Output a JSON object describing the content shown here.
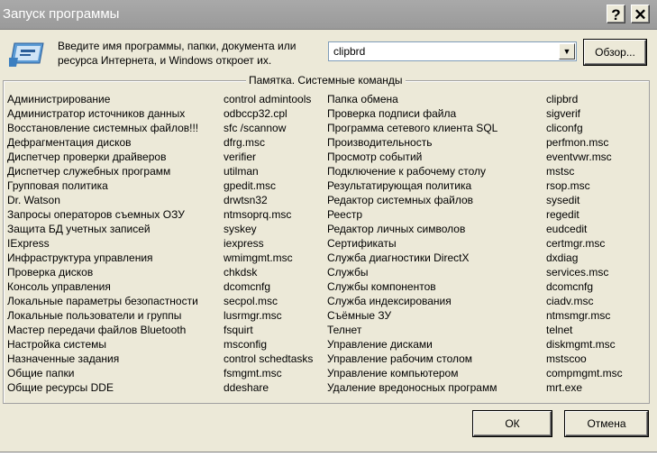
{
  "window": {
    "title": "Запуск программы",
    "help_label": "?",
    "close_label": "✕"
  },
  "prompt": "Введите имя программы, папки, документа или ресурса Интернета, и Windows откроет их.",
  "input": {
    "value": "clipbrd"
  },
  "buttons": {
    "browse": "Обзор...",
    "ok": "ОК",
    "cancel": "Отмена"
  },
  "group_title": "Памятка. Системные команды",
  "commands": [
    [
      "Администрирование",
      "control admintools",
      "Папка обмена",
      "clipbrd"
    ],
    [
      "Администратор источников данных",
      "odbccp32.cpl",
      "Проверка подписи файла",
      "sigverif"
    ],
    [
      "Восстановление системных файлов!!!",
      "sfc /scannow",
      "Программа сетевого клиента SQL",
      "cliconfg"
    ],
    [
      "Дефрагментация дисков",
      "dfrg.msc",
      "Производительность",
      "perfmon.msc"
    ],
    [
      "Диспетчер проверки драйверов",
      "verifier",
      "Просмотр событий",
      "eventvwr.msc"
    ],
    [
      "Диспетчер служебных программ",
      "utilman",
      "Подключение к рабочему столу",
      "mstsc"
    ],
    [
      "Групповая политика",
      "gpedit.msc",
      "Результатирующая политика",
      "rsop.msc"
    ],
    [
      "Dr. Watson",
      "drwtsn32",
      "Редактор системных файлов",
      "sysedit"
    ],
    [
      "Запросы операторов съемных ОЗУ",
      "ntmsoprq.msc",
      "Реестр",
      "regedit"
    ],
    [
      "Защита БД учетных записей",
      "syskey",
      "Редактор личных символов",
      "eudcedit"
    ],
    [
      "IExpress",
      "iexpress",
      "Сертификаты",
      "certmgr.msc"
    ],
    [
      "Инфраструктура управления",
      "wmimgmt.msc",
      "Служба диагностики DirectX",
      "dxdiag"
    ],
    [
      "Проверка дисков",
      "chkdsk",
      "Службы",
      "services.msc"
    ],
    [
      "Консоль управления",
      "dcomcnfg",
      "Службы компонентов",
      "dcomcnfg"
    ],
    [
      "Локальные параметры безопастности",
      "secpol.msc",
      "Служба индексирования",
      "ciadv.msc"
    ],
    [
      "Локальные пользователи и группы",
      "lusrmgr.msc",
      "Съёмные ЗУ",
      "ntmsmgr.msc"
    ],
    [
      "Мастер передачи файлов Bluetooth",
      "fsquirt",
      "Телнет",
      "telnet"
    ],
    [
      "Настройка системы",
      "msconfig",
      "Управление дисками",
      "diskmgmt.msc"
    ],
    [
      "Назначенные задания",
      "control schedtasks",
      "Управление рабочим столом",
      "mstscoo"
    ],
    [
      "Общие папки",
      "fsmgmt.msc",
      "Управление компьютером",
      "compmgmt.msc"
    ],
    [
      "Общие ресурсы DDE",
      "ddeshare",
      "Удаление вредоносных программ",
      "mrt.exe"
    ]
  ]
}
